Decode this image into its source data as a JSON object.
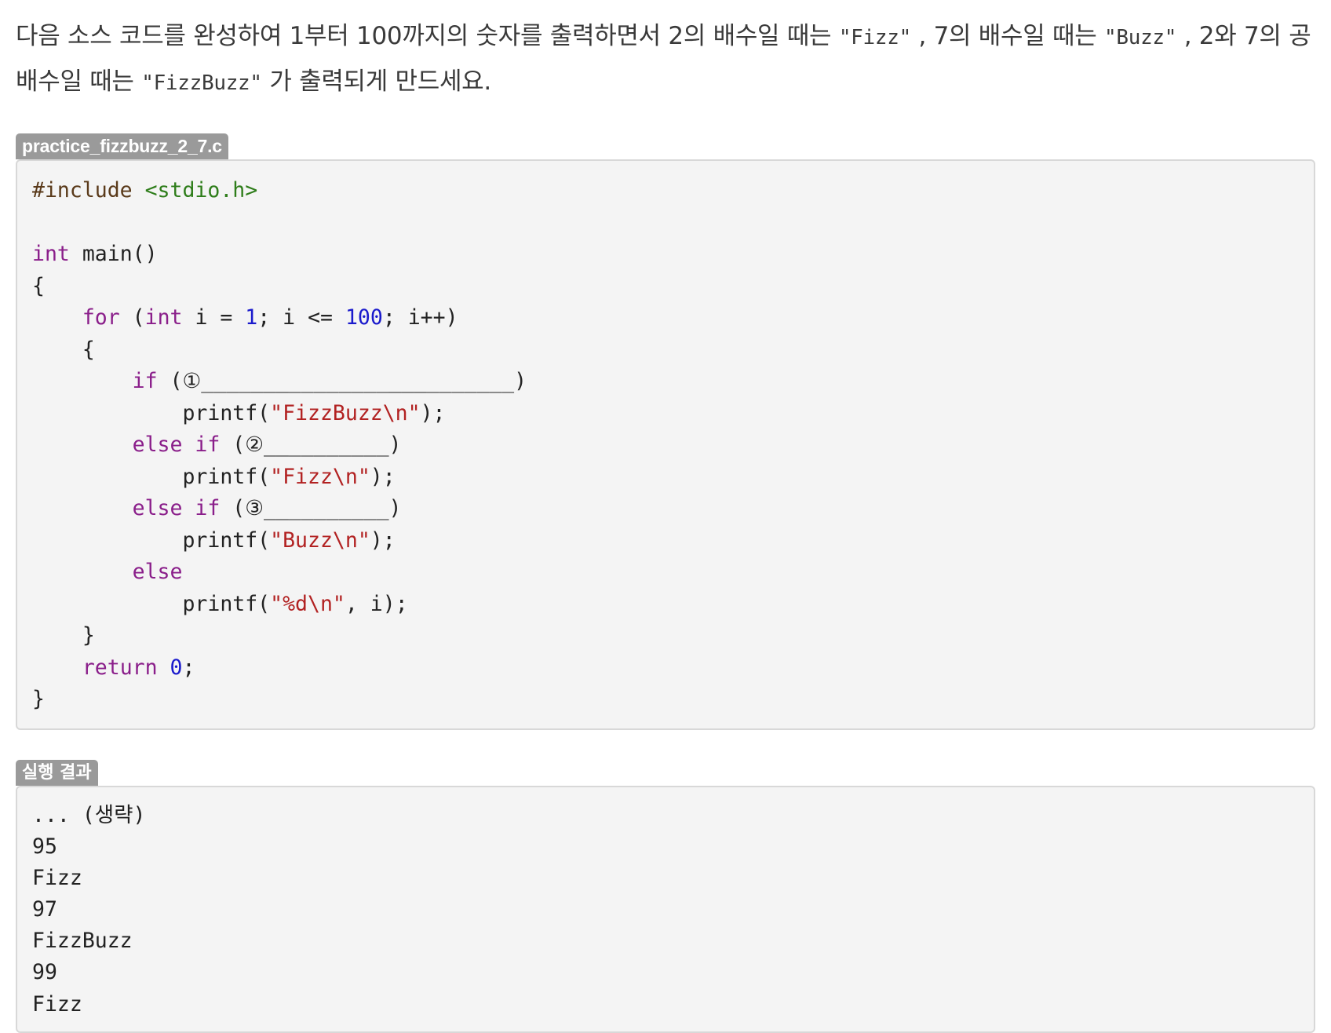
{
  "intro": {
    "part1": "다음 소스 코드를 완성하여 1부터 100까지의 숫자를 출력하면서 2의 배수일 때는 ",
    "code1": "\"Fizz\"",
    "part2": " , 7의 배수일 때는 ",
    "code2": "\"Buzz\"",
    "part3": " , 2와 7의 공배수일 때는 ",
    "code3": "\"FizzBuzz\"",
    "part4": " 가 출력되게 만드세요."
  },
  "file_label": "practice_fizzbuzz_2_7.c",
  "code": {
    "l1_pp": "#include ",
    "l1_inc": "<stdio.h>",
    "l3_kw": "int",
    "l3_rest": " main()",
    "l4": "{",
    "l5_indent": "    ",
    "l5_kw1": "for",
    "l5_a": " (",
    "l5_kw2": "int",
    "l5_b": " i = ",
    "l5_n1": "1",
    "l5_c": "; i <= ",
    "l5_n2": "100",
    "l5_d": "; i++)",
    "l6": "    {",
    "l7_indent": "        ",
    "l7_kw": "if",
    "l7_rest": " (①_________________________)",
    "l8_a": "            printf(",
    "l8_str": "\"FizzBuzz\\n\"",
    "l8_b": ");",
    "l9_indent": "        ",
    "l9_kw": "else if",
    "l9_rest": " (②__________)",
    "l10_a": "            printf(",
    "l10_str": "\"Fizz\\n\"",
    "l10_b": ");",
    "l11_indent": "        ",
    "l11_kw": "else if",
    "l11_rest": " (③__________)",
    "l12_a": "            printf(",
    "l12_str": "\"Buzz\\n\"",
    "l12_b": ");",
    "l13_indent": "        ",
    "l13_kw": "else",
    "l14_a": "            printf(",
    "l14_str": "\"%d\\n\"",
    "l14_b": ", i);",
    "l15": "    }",
    "l16_indent": "    ",
    "l16_kw": "return",
    "l16_sp": " ",
    "l16_num": "0",
    "l16_end": ";",
    "l17": "}"
  },
  "output_label": "실행 결과",
  "output_lines": [
    "... (생략)",
    "95",
    "Fizz",
    "97",
    "FizzBuzz",
    "99",
    "Fizz"
  ]
}
